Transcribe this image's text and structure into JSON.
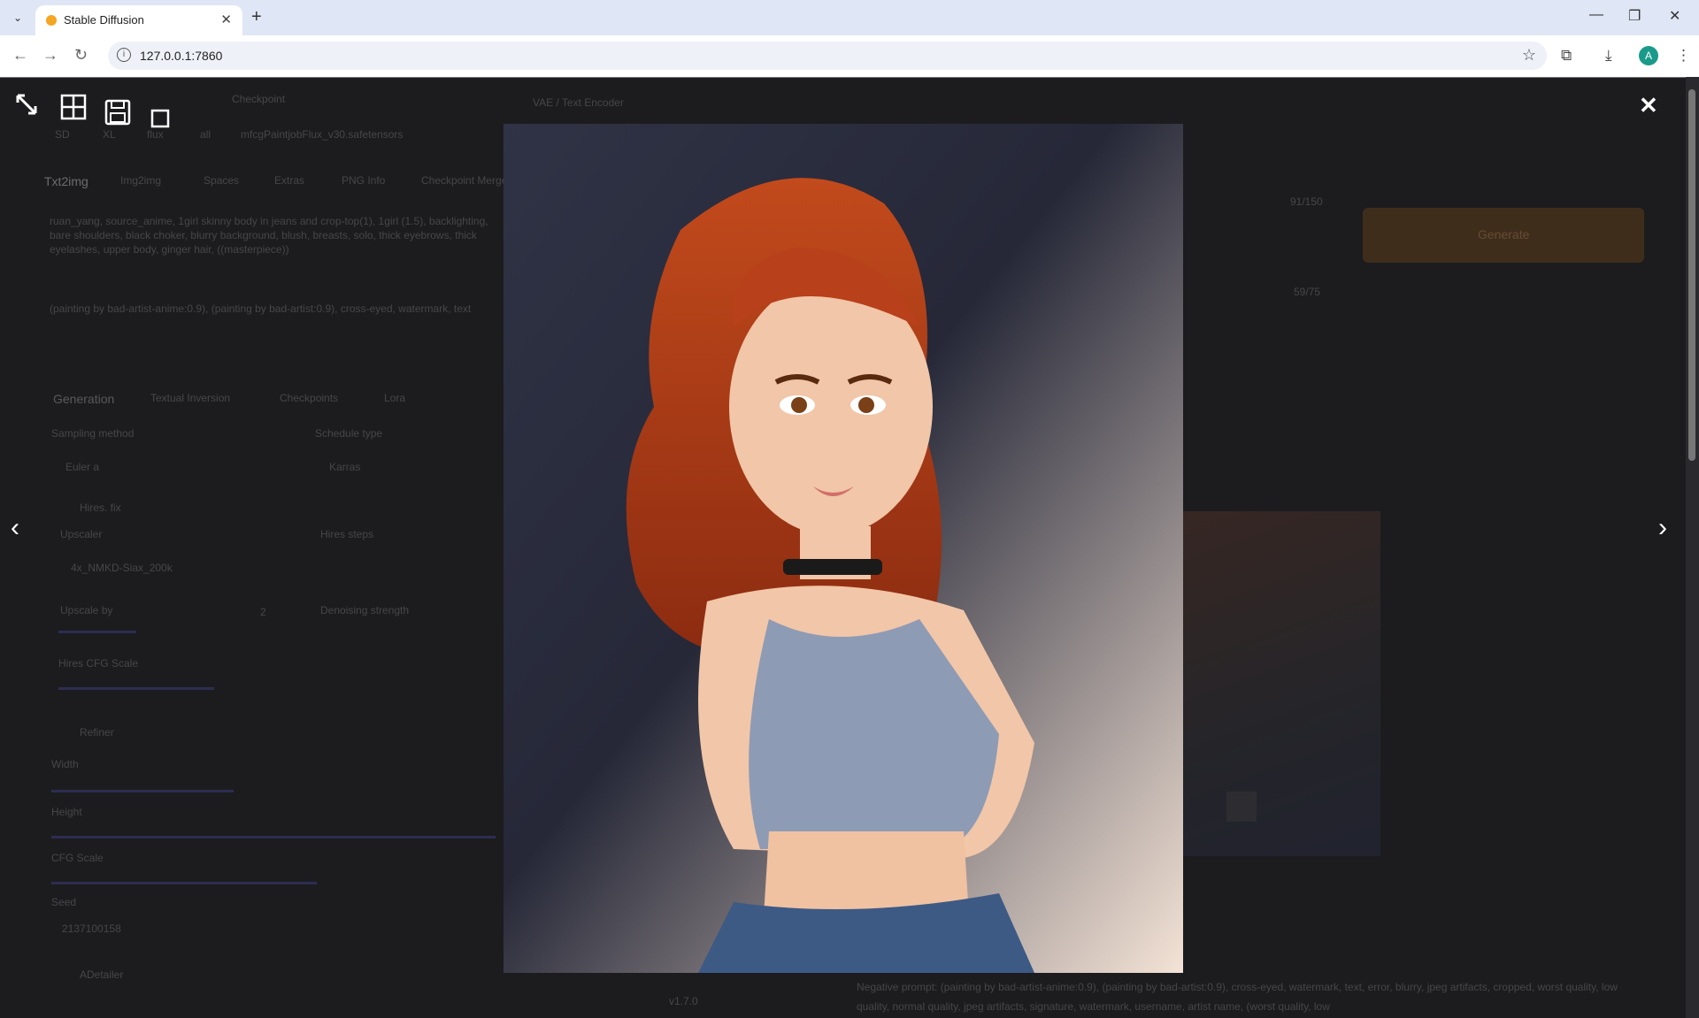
{
  "browser": {
    "tab_title": "Stable Diffusion",
    "url": "127.0.0.1:7860",
    "avatar_letter": "A"
  },
  "page_behind": {
    "checkpoint_label": "Checkpoint",
    "checkpoint_value": "mfcgPaintjobFlux_v30.safetensors",
    "vae_label": "VAE / Text Encoder",
    "models": [
      "SD",
      "XL",
      "flux",
      "all"
    ],
    "tabs": [
      "Txt2img",
      "Img2img",
      "Spaces",
      "Extras",
      "PNG Info",
      "Checkpoint Merger"
    ],
    "prompt": "ruan_yang, source_anime, 1girl skinny body in jeans and crop-top(1), 1girl (1.5), backlighting, bare shoulders, black choker, blurry background, blush, breasts, solo, thick eyebrows, thick eyelashes, upper body, ginger hair, ((masterpiece))",
    "negative_prompt": "(painting by bad-artist-anime:0.9), (painting by bad-artist:0.9), cross-eyed, watermark, text",
    "gen_tabs": [
      "Generation",
      "Textual Inversion",
      "Checkpoints",
      "Lora"
    ],
    "sampling_method_label": "Sampling method",
    "sampling_method": "Euler a",
    "schedule_label": "Schedule type",
    "schedule": "Karras",
    "hires_fix": "Hires. fix",
    "upscaler_label": "Upscaler",
    "upscaler": "4x_NMKD-Siax_200k",
    "hires_steps_label": "Hires steps",
    "upscale_by_label": "Upscale by",
    "upscale_by": "2",
    "denoising_label": "Denoising strength",
    "hires_cfg_label": "Hires CFG Scale",
    "refiner_label": "Refiner",
    "width_label": "Width",
    "height_label": "Height",
    "cfg_label": "CFG Scale",
    "seed_label": "Seed",
    "seed": "2137100158",
    "adetailer": "ADetailer",
    "progress": "91/150",
    "eta": "59/75",
    "generate_label": "Generate",
    "version": "v1.7.0",
    "negative_info": "Negative prompt: (painting by bad-artist-anime:0.9), (painting by bad-artist:0.9), cross-eyed, watermark, text, error, blurry, jpeg artifacts, cropped, worst quality, low quality, normal quality, jpeg artifacts, signature, watermark, username, artist name, (worst quality, low"
  },
  "overlay": {
    "icons": [
      "fullscreen-icon",
      "tile-icon",
      "save-icon",
      "zoom-icon"
    ],
    "close_glyph": "✕",
    "prev_glyph": "‹",
    "next_glyph": "›"
  }
}
